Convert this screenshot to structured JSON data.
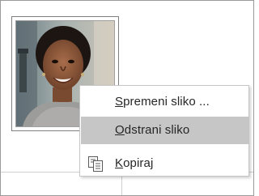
{
  "profile_photo": {
    "icon": "person-photo"
  },
  "context_menu": {
    "items": [
      {
        "accel": "S",
        "rest": "premeni sliko ...",
        "icon": ""
      },
      {
        "accel": "O",
        "rest": "dstrani sliko",
        "icon": ""
      },
      {
        "accel": "K",
        "rest": "opiraj",
        "icon": "copy-icon"
      }
    ],
    "highlight_color": "#c6c6c6"
  }
}
